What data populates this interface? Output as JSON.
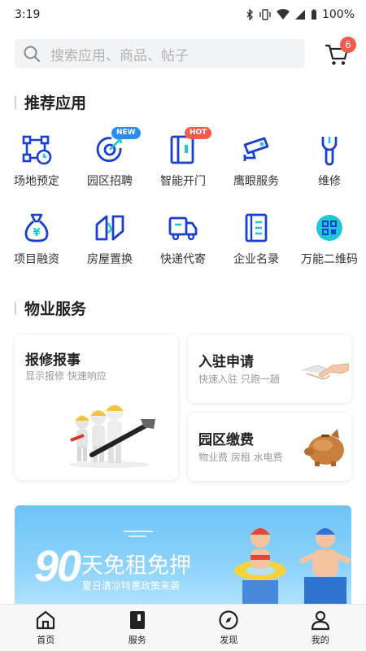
{
  "status_bar": {
    "time": "3:19",
    "battery": "100%"
  },
  "search": {
    "placeholder": "搜索应用、商品、帖子"
  },
  "cart": {
    "badge": "6"
  },
  "sections": {
    "recommended": "推荐应用",
    "property": "物业服务"
  },
  "apps": [
    {
      "label": "场地预定",
      "icon": "venue-booking-icon"
    },
    {
      "label": "园区招聘",
      "icon": "recruit-icon",
      "tag": "NEW"
    },
    {
      "label": "智能开门",
      "icon": "smart-door-icon",
      "tag": "HOT"
    },
    {
      "label": "鹰眼服务",
      "icon": "camera-icon"
    },
    {
      "label": "维修",
      "icon": "wrench-icon"
    },
    {
      "label": "项目融资",
      "icon": "money-bag-icon"
    },
    {
      "label": "房屋置换",
      "icon": "house-swap-icon"
    },
    {
      "label": "快递代寄",
      "icon": "delivery-truck-icon"
    },
    {
      "label": "企业名录",
      "icon": "directory-icon"
    },
    {
      "label": "万能二维码",
      "icon": "qr-code-icon"
    }
  ],
  "cards": {
    "repair": {
      "title": "报修报事",
      "subtitle": "显示报修 快速响应"
    },
    "settle": {
      "title": "入驻申请",
      "subtitle": "快速入驻 只跑一趟"
    },
    "fees": {
      "title": "园区缴费",
      "subtitle": "物业费 房租 水电费"
    }
  },
  "banner": {
    "big_number": "90",
    "title": "天免租免押",
    "subtitle": "夏日清凉特惠政策来袭"
  },
  "nav": [
    {
      "label": "首页",
      "icon": "home-icon"
    },
    {
      "label": "服务",
      "icon": "service-icon"
    },
    {
      "label": "发现",
      "icon": "compass-icon"
    },
    {
      "label": "我的",
      "icon": "profile-icon"
    }
  ],
  "colors": {
    "accent_blue": "#1a3fcf",
    "icon_teal": "#1cc7d6",
    "badge_red": "#f35b4b",
    "tag_blue": "#2b8cf0"
  }
}
